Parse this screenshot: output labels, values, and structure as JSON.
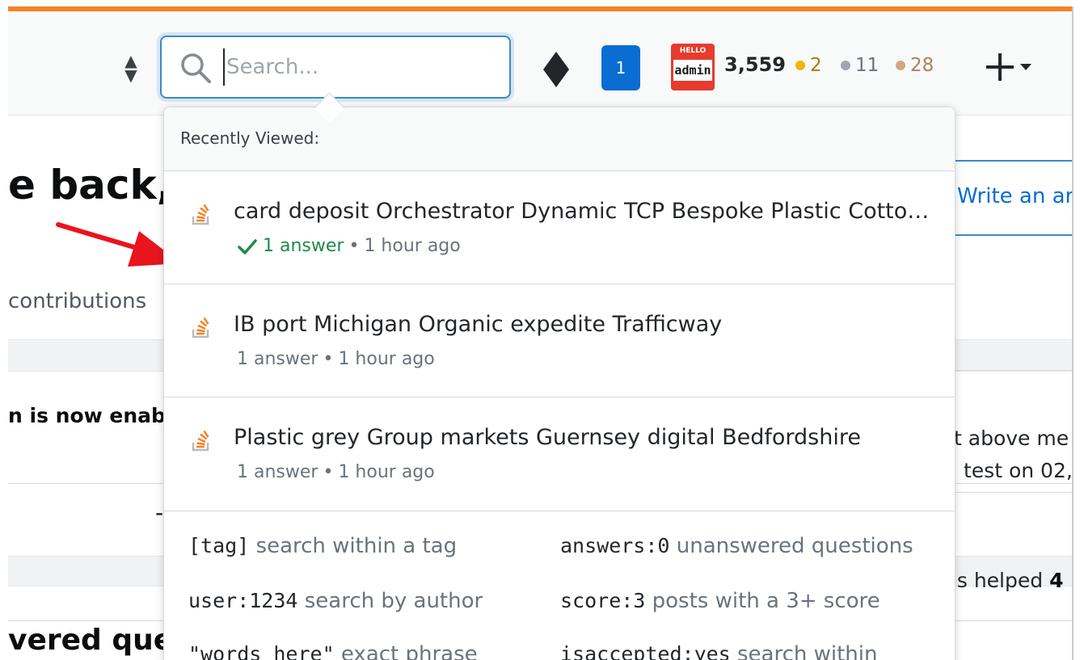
{
  "search": {
    "placeholder": "Search..."
  },
  "topbar": {
    "inbox_count": "1",
    "avatar": {
      "top_text": "HELLO",
      "name_text": "admin"
    },
    "reputation": "3,559",
    "badges": {
      "gold": "2",
      "silver": "11",
      "bronze": "28"
    },
    "colors": {
      "accent": "#f48225",
      "gold": "#f1b600",
      "silver": "#9fa6ad",
      "bronze": "#d1a684"
    }
  },
  "background": {
    "welcome_fragment": "e back,",
    "contributions": "contributions",
    "notice_fragment": "n is now enab",
    "dash": "-",
    "unanswered_fragment": "vered ques",
    "write_answer": "Write an ar",
    "above_text": "t above me",
    "test_on": "test on 02,",
    "helped_prefix": "ns helped ",
    "helped_value": "4"
  },
  "dropdown": {
    "header": "Recently Viewed:",
    "items": [
      {
        "title": "card deposit Orchestrator Dynamic TCP Bespoke Plastic Cotton...",
        "answers": "1 answer",
        "time": "1 hour ago",
        "accepted": true
      },
      {
        "title": "IB port Michigan Organic expedite Trafficway",
        "answers": "1 answer",
        "time": "1 hour ago",
        "accepted": false
      },
      {
        "title": "Plastic grey Group markets Guernsey digital Bedfordshire",
        "answers": "1 answer",
        "time": "1 hour ago",
        "accepted": false
      }
    ],
    "separator": "•",
    "tips": [
      {
        "code": "[tag]",
        "desc": "search within a tag"
      },
      {
        "code": "answers:0",
        "desc": "unanswered questions"
      },
      {
        "code": "user:1234",
        "desc": "search by author"
      },
      {
        "code": "score:3",
        "desc": "posts with a 3+ score"
      },
      {
        "code": "\"words here\"",
        "desc": "exact phrase"
      },
      {
        "code": "isaccepted:yes",
        "desc": "search within"
      }
    ]
  }
}
